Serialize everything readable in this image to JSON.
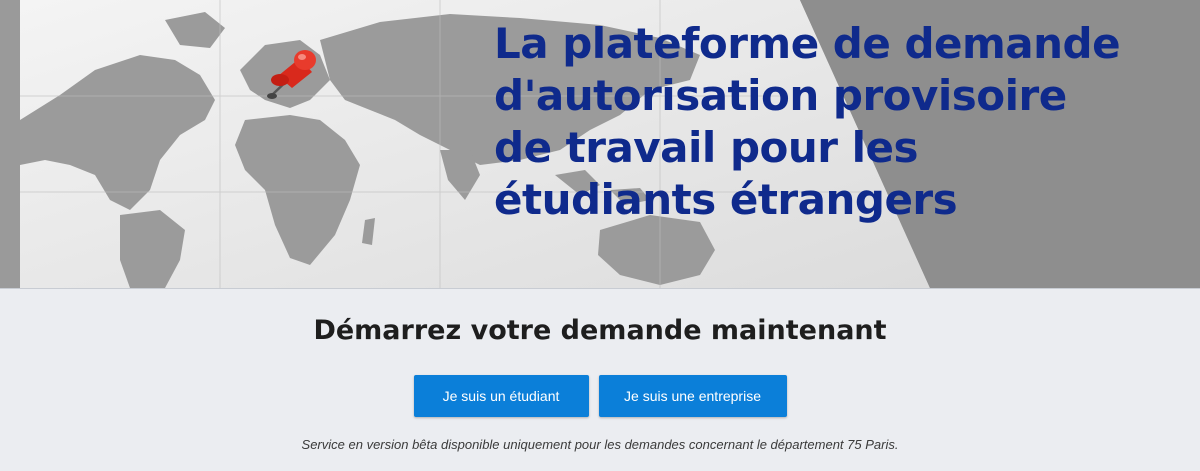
{
  "hero": {
    "title": "La plateforme de demande d'autorisation provisoire de travail pour les étudiants étrangers"
  },
  "cta": {
    "heading": "Démarrez votre demande maintenant",
    "student_button": "Je suis un étudiant",
    "company_button": "Je suis une entreprise"
  },
  "footer_note": "Service en version bêta disponible uniquement pour les demandes concernant le département 75 Paris.",
  "colors": {
    "title_blue": "#0f2a8c",
    "button_blue": "#0b7fd9",
    "page_background": "#ebedf1"
  }
}
